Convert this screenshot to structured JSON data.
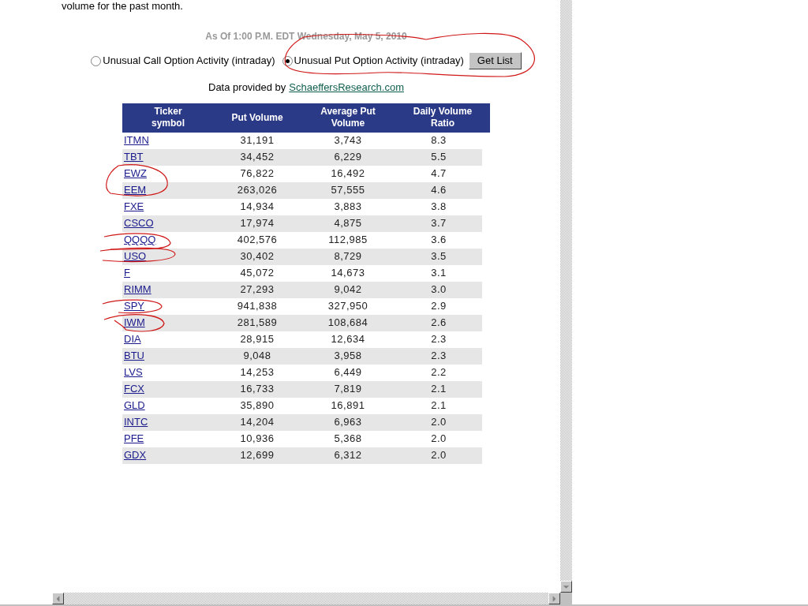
{
  "intro_text": "volume for the past month.",
  "as_of": "As Of 1:00 P.M. EDT Wednesday, May 5, 2010",
  "report_options": [
    {
      "label": "Unusual Call Option Activity (intraday)",
      "selected": false
    },
    {
      "label": "Unusual Put Option Activity (intraday)",
      "selected": true
    }
  ],
  "get_list_button": "Get List",
  "attribution": {
    "text": "Data provided by",
    "link": "SchaeffersResearch.com"
  },
  "table": {
    "columns": [
      "Ticker symbol",
      "Put Volume",
      "Average Put Volume",
      "Daily Volume Ratio"
    ],
    "rows": [
      [
        "ITMN",
        "31,191",
        "3,743",
        "8.3"
      ],
      [
        "TBT",
        "34,452",
        "6,229",
        "5.5"
      ],
      [
        "EWZ",
        "76,822",
        "16,492",
        "4.7"
      ],
      [
        "EEM",
        "263,026",
        "57,555",
        "4.6"
      ],
      [
        "FXE",
        "14,934",
        "3,883",
        "3.8"
      ],
      [
        "CSCO",
        "17,974",
        "4,875",
        "3.7"
      ],
      [
        "QQQQ",
        "402,576",
        "112,985",
        "3.6"
      ],
      [
        "USO",
        "30,402",
        "8,729",
        "3.5"
      ],
      [
        "F",
        "45,072",
        "14,673",
        "3.1"
      ],
      [
        "RIMM",
        "27,293",
        "9,042",
        "3.0"
      ],
      [
        "SPY",
        "941,838",
        "327,950",
        "2.9"
      ],
      [
        "IWM",
        "281,589",
        "108,684",
        "2.6"
      ],
      [
        "DIA",
        "28,915",
        "12,634",
        "2.3"
      ],
      [
        "BTU",
        "9,048",
        "3,958",
        "2.3"
      ],
      [
        "LVS",
        "14,253",
        "6,449",
        "2.2"
      ],
      [
        "FCX",
        "16,733",
        "7,819",
        "2.1"
      ],
      [
        "GLD",
        "35,890",
        "16,891",
        "2.1"
      ],
      [
        "INTC",
        "14,204",
        "6,963",
        "2.0"
      ],
      [
        "PFE",
        "10,936",
        "5,368",
        "2.0"
      ],
      [
        "GDX",
        "12,699",
        "6,312",
        "2.0"
      ]
    ]
  }
}
